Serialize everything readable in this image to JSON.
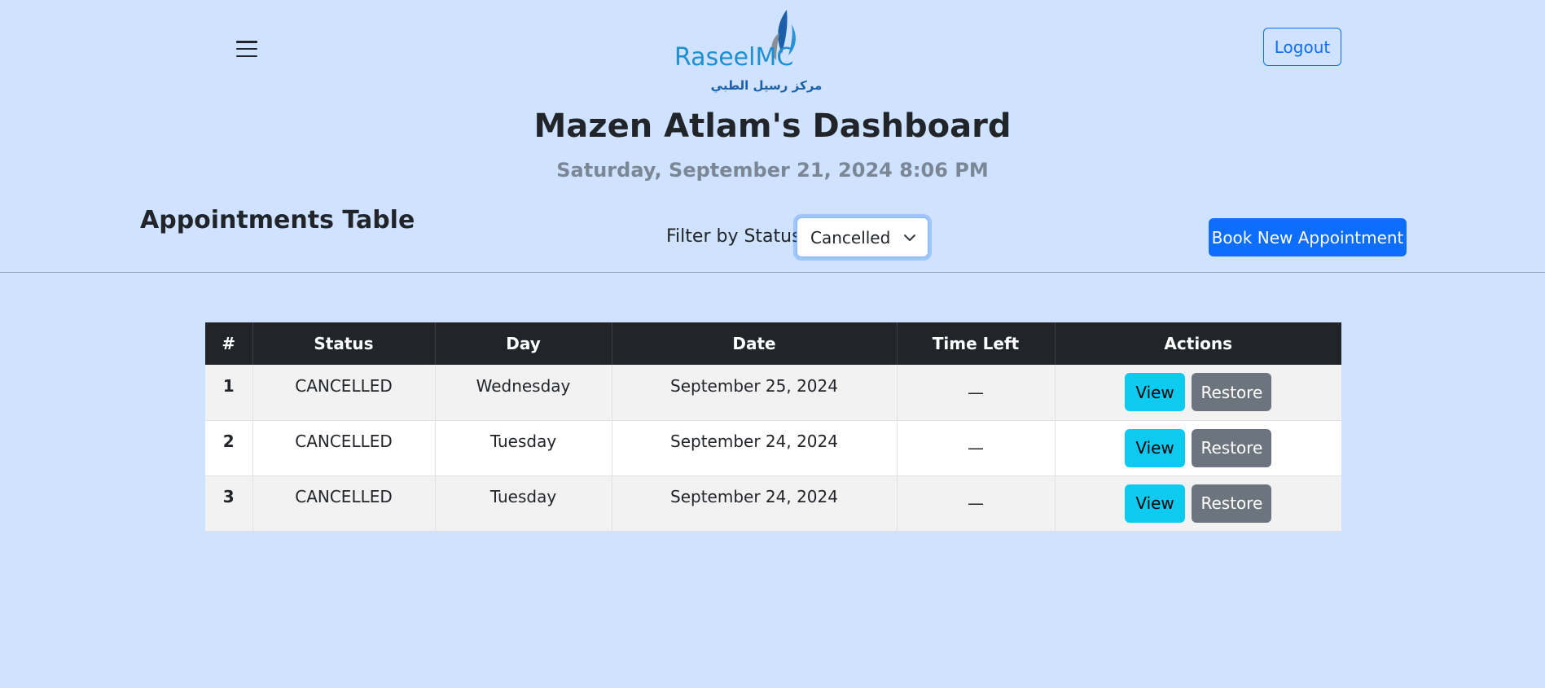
{
  "header": {
    "logo": {
      "text_en": "RaseelMC",
      "text_ar": "مركز رسيل الطبي"
    },
    "logout_label": "Logout"
  },
  "dashboard": {
    "title": "Mazen Atlam's Dashboard",
    "datetime": "Saturday, September 21, 2024 8:06 PM"
  },
  "appointments": {
    "section_title": "Appointments Table",
    "filter_label": "Filter by Status:",
    "filter_value": "Cancelled",
    "book_label": "Book New Appointment",
    "columns": [
      "#",
      "Status",
      "Day",
      "Date",
      "Time Left",
      "Actions"
    ],
    "rows": [
      {
        "num": "1",
        "status": "CANCELLED",
        "day": "Wednesday",
        "date": "September 25, 2024",
        "time_left": "—",
        "view_label": "View",
        "restore_label": "Restore"
      },
      {
        "num": "2",
        "status": "CANCELLED",
        "day": "Tuesday",
        "date": "September 24, 2024",
        "time_left": "—",
        "view_label": "View",
        "restore_label": "Restore"
      },
      {
        "num": "3",
        "status": "CANCELLED",
        "day": "Tuesday",
        "date": "September 24, 2024",
        "time_left": "—",
        "view_label": "View",
        "restore_label": "Restore"
      }
    ]
  },
  "colors": {
    "background": "#cfe2ff",
    "primary": "#0d6efd",
    "info": "#0dcaf0",
    "secondary": "#6c757d",
    "table_header": "#212529"
  }
}
